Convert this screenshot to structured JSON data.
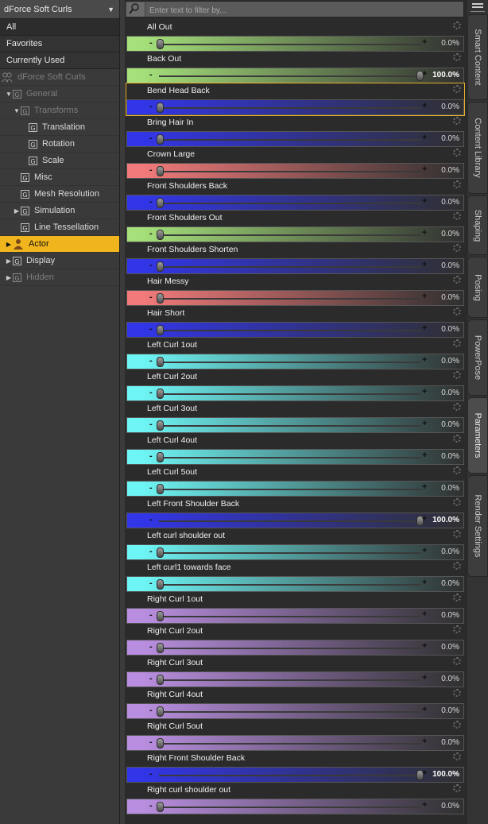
{
  "left": {
    "node_select": "dForce Soft Curls",
    "filters": [
      {
        "label": "All",
        "selected": true
      },
      {
        "label": "Favorites",
        "selected": false
      },
      {
        "label": "Currently Used",
        "selected": false
      }
    ],
    "tree_root": "dForce Soft Curls",
    "tree": [
      {
        "label": "General",
        "level": 1,
        "arrow": "down",
        "dim": true
      },
      {
        "label": "Transforms",
        "level": 2,
        "arrow": "down",
        "dim": true
      },
      {
        "label": "Translation",
        "level": 3,
        "arrow": "",
        "dim": false
      },
      {
        "label": "Rotation",
        "level": 3,
        "arrow": "",
        "dim": false
      },
      {
        "label": "Scale",
        "level": 3,
        "arrow": "",
        "dim": false
      },
      {
        "label": "Misc",
        "level": 2,
        "arrow": "",
        "dim": false
      },
      {
        "label": "Mesh Resolution",
        "level": 2,
        "arrow": "",
        "dim": false
      },
      {
        "label": "Simulation",
        "level": 2,
        "arrow": "right",
        "dim": false
      },
      {
        "label": "Line Tessellation",
        "level": 2,
        "arrow": "",
        "dim": false
      },
      {
        "label": "Actor",
        "level": 1,
        "arrow": "right",
        "dim": false,
        "active": true,
        "icon": "figure-icon"
      },
      {
        "label": "Display",
        "level": 1,
        "arrow": "right",
        "dim": false
      },
      {
        "label": "Hidden",
        "level": 1,
        "arrow": "right",
        "dim": true
      }
    ]
  },
  "search": {
    "placeholder": "Enter text to filter by..."
  },
  "params": [
    {
      "label": "All  Out",
      "value": "0.0%",
      "fraction": 0,
      "color": "#a5e07a"
    },
    {
      "label": "Back Out",
      "value": "100.0%",
      "fraction": 1,
      "color": "#a5e07a"
    },
    {
      "label": "Bend Head Back",
      "value": "0.0%",
      "fraction": 0,
      "color": "#3235e8",
      "selected": true
    },
    {
      "label": "Bring Hair In",
      "value": "0.0%",
      "fraction": 0,
      "color": "#3235e8"
    },
    {
      "label": "Crown Large",
      "value": "0.0%",
      "fraction": 0,
      "color": "#f27a7a"
    },
    {
      "label": "Front Shoulders Back",
      "value": "0.0%",
      "fraction": 0,
      "color": "#3235e8"
    },
    {
      "label": "Front Shoulders Out",
      "value": "0.0%",
      "fraction": 0,
      "color": "#a5e07a"
    },
    {
      "label": "Front Shoulders Shorten",
      "value": "0.0%",
      "fraction": 0,
      "color": "#3235e8"
    },
    {
      "label": "Hair Messy",
      "value": "0.0%",
      "fraction": 0,
      "color": "#f27a7a"
    },
    {
      "label": "Hair Short",
      "value": "0.0%",
      "fraction": 0,
      "color": "#3235e8"
    },
    {
      "label": "Left Curl 1out",
      "value": "0.0%",
      "fraction": 0,
      "color": "#6ef5f5"
    },
    {
      "label": "Left Curl 2out",
      "value": "0.0%",
      "fraction": 0,
      "color": "#6ef5f5"
    },
    {
      "label": "Left Curl 3out",
      "value": "0.0%",
      "fraction": 0,
      "color": "#6ef5f5"
    },
    {
      "label": "Left Curl 4out",
      "value": "0.0%",
      "fraction": 0,
      "color": "#6ef5f5"
    },
    {
      "label": "Left Curl 5out",
      "value": "0.0%",
      "fraction": 0,
      "color": "#6ef5f5"
    },
    {
      "label": "Left Front Shoulder Back",
      "value": "100.0%",
      "fraction": 1,
      "color": "#3235e8"
    },
    {
      "label": "Left curl shoulder out",
      "value": "0.0%",
      "fraction": 0,
      "color": "#6ef5f5"
    },
    {
      "label": "Left curl1 towards face",
      "value": "0.0%",
      "fraction": 0,
      "color": "#6ef5f5"
    },
    {
      "label": "Right Curl 1out",
      "value": "0.0%",
      "fraction": 0,
      "color": "#b98ee0"
    },
    {
      "label": "Right Curl 2out",
      "value": "0.0%",
      "fraction": 0,
      "color": "#b98ee0"
    },
    {
      "label": "Right Curl 3out",
      "value": "0.0%",
      "fraction": 0,
      "color": "#b98ee0"
    },
    {
      "label": "Right Curl 4out",
      "value": "0.0%",
      "fraction": 0,
      "color": "#b98ee0"
    },
    {
      "label": "Right Curl 5out",
      "value": "0.0%",
      "fraction": 0,
      "color": "#b98ee0"
    },
    {
      "label": "Right Front Shoulder Back",
      "value": "100.0%",
      "fraction": 1,
      "color": "#3235e8"
    },
    {
      "label": "Right curl shoulder out",
      "value": "0.0%",
      "fraction": 0,
      "color": "#b98ee0"
    }
  ],
  "tabs": [
    {
      "label": "Smart Content",
      "active": false
    },
    {
      "label": "Content Library",
      "active": false
    },
    {
      "label": "Shaping",
      "active": false
    },
    {
      "label": "Posing",
      "active": false
    },
    {
      "label": "PowerPose",
      "active": false
    },
    {
      "label": "Parameters",
      "active": true
    },
    {
      "label": "Render Settings",
      "active": false
    }
  ]
}
